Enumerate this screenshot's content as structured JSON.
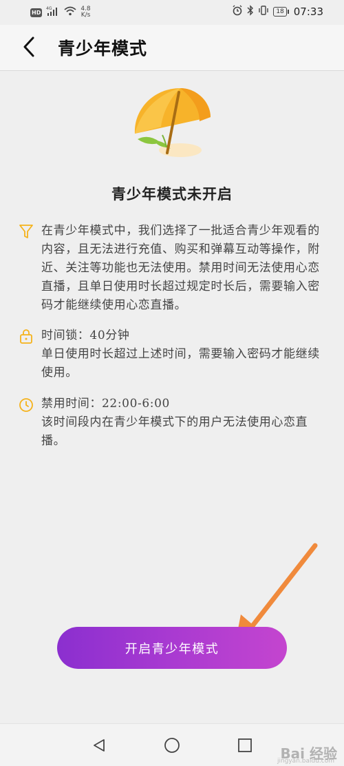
{
  "status_bar": {
    "hd": "HD",
    "signal_label": "4G",
    "net_speed_value": "4.8",
    "net_speed_unit": "K/s",
    "battery": "18",
    "time": "07:33"
  },
  "header": {
    "title": "青少年模式"
  },
  "status_title": "青少年模式未开启",
  "info": [
    {
      "icon": "funnel-icon",
      "text": "在青少年模式中，我们选择了一批适合青少年观看的内容，且无法进行充值、购买和弹幕互动等操作，附近、关注等功能也无法使用。禁用时间无法使用心恋直播，且单日使用时长超过规定时长后，需要输入密码才能继续使用心恋直播。"
    },
    {
      "icon": "lock-icon",
      "text_line1": "时间锁：40分钟",
      "text_line2": "单日使用时长超过上述时间，需要输入密码才能继续使用。"
    },
    {
      "icon": "clock-icon",
      "text_line1": "禁用时间：22:00-6:00",
      "text_line2": "该时间段内在青少年模式下的用户无法使用心恋直播。"
    }
  ],
  "button_label": "开启青少年模式",
  "watermark": "Bai 经验",
  "watermark_sub": "jingyan.baidu.com",
  "colors": {
    "accent": "#f5b21a",
    "button_start": "#8b2fcf",
    "button_end": "#c445cf",
    "arrow": "#f08a3c"
  }
}
